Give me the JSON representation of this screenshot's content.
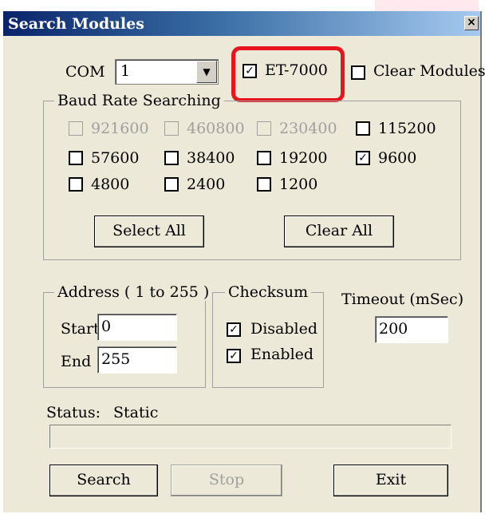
{
  "window": {
    "title": "Search Modules",
    "close_glyph": "×"
  },
  "com": {
    "label": "COM",
    "value": "1",
    "dropdown_glyph": "▼"
  },
  "options": [
    {
      "label": "ET-7000",
      "checked": true
    },
    {
      "label": "Clear Modules",
      "checked": false
    }
  ],
  "baud": {
    "group_label": "Baud Rate Searching",
    "rates": [
      {
        "label": "921600",
        "checked": false,
        "enabled": false
      },
      {
        "label": "460800",
        "checked": false,
        "enabled": false
      },
      {
        "label": "230400",
        "checked": false,
        "enabled": false
      },
      {
        "label": "115200",
        "checked": false,
        "enabled": true
      },
      {
        "label": "57600",
        "checked": false,
        "enabled": true
      },
      {
        "label": "38400",
        "checked": false,
        "enabled": true
      },
      {
        "label": "19200",
        "checked": false,
        "enabled": true
      },
      {
        "label": "9600",
        "checked": true,
        "enabled": true
      },
      {
        "label": "4800",
        "checked": false,
        "enabled": true
      },
      {
        "label": "2400",
        "checked": false,
        "enabled": true
      },
      {
        "label": "1200",
        "checked": false,
        "enabled": true
      }
    ],
    "select_all_label": "Select All",
    "clear_all_label": "Clear All"
  },
  "address": {
    "group_label": "Address ( 1 to 255 )",
    "start_label": "Start",
    "start_value": "0",
    "end_label": "End",
    "end_value": "255"
  },
  "checksum": {
    "group_label": "Checksum",
    "items": [
      {
        "label": "Disabled",
        "checked": true
      },
      {
        "label": "Enabled",
        "checked": true
      }
    ]
  },
  "timeout": {
    "label": "Timeout (mSec)",
    "value": "200"
  },
  "status": {
    "label": "Status:",
    "value": "Static",
    "progress": 0
  },
  "buttons": {
    "search": "Search",
    "stop": "Stop",
    "exit": "Exit"
  },
  "check_glyph": "✓"
}
